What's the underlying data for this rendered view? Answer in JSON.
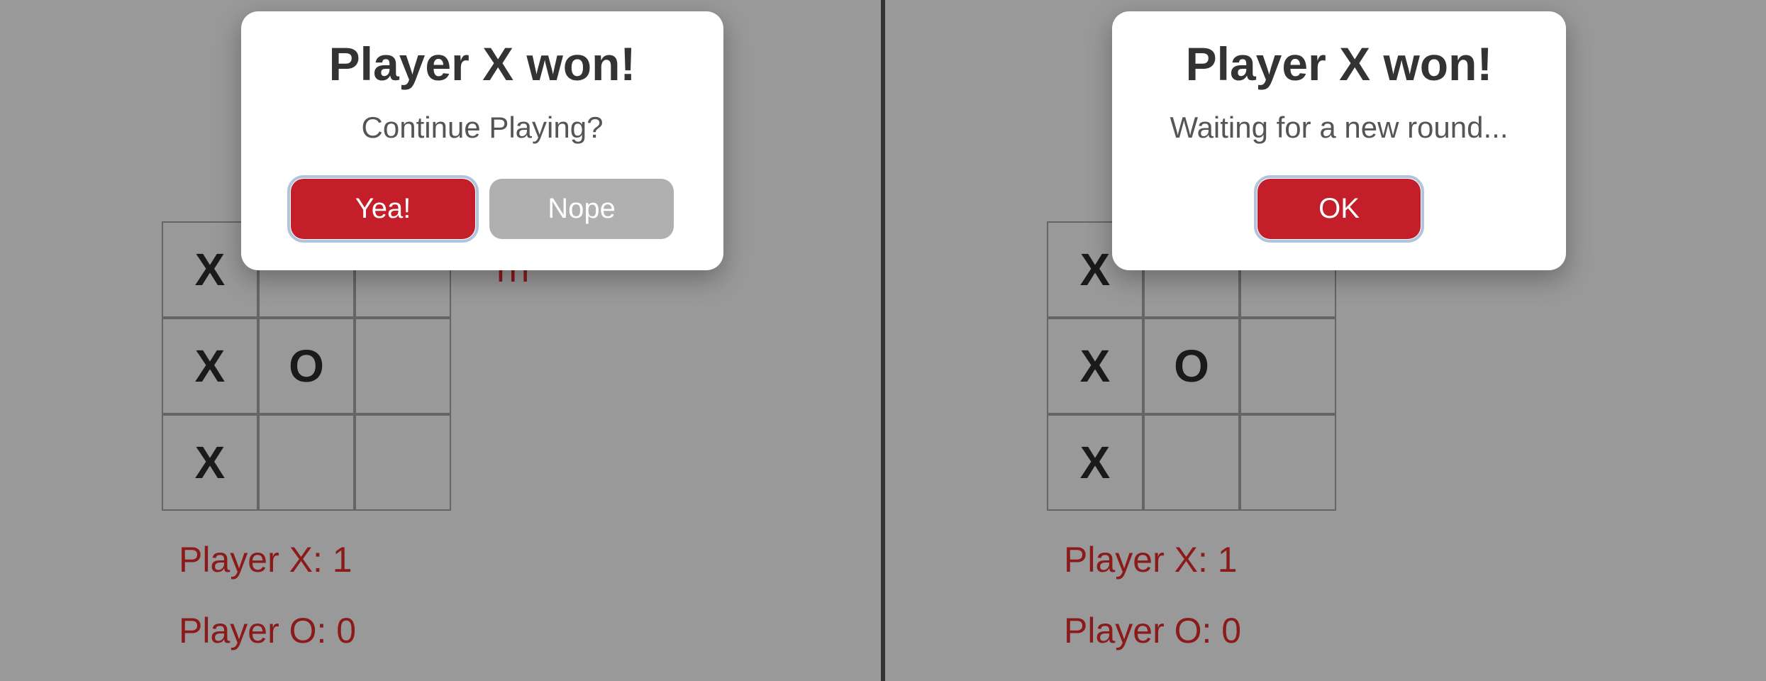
{
  "left": {
    "dialog": {
      "title": "Player X won!",
      "subtitle": "Continue Playing?",
      "yes_label": "Yea!",
      "no_label": "Nope"
    },
    "turn_text_fragment": "rn",
    "board": {
      "cells": [
        "X",
        "",
        "",
        "X",
        "O",
        "",
        "X",
        "",
        ""
      ]
    },
    "score_x_label": "Player X: ",
    "score_x_value": "1",
    "score_o_label": "Player O: ",
    "score_o_value": "0"
  },
  "right": {
    "dialog": {
      "title": "Player X won!",
      "subtitle": "Waiting for a new round...",
      "ok_label": "OK"
    },
    "board": {
      "cells": [
        "X",
        "",
        "",
        "X",
        "O",
        "",
        "X",
        "",
        ""
      ]
    },
    "score_x_label": "Player X: ",
    "score_x_value": "1",
    "score_o_label": "Player O: ",
    "score_o_value": "0"
  }
}
